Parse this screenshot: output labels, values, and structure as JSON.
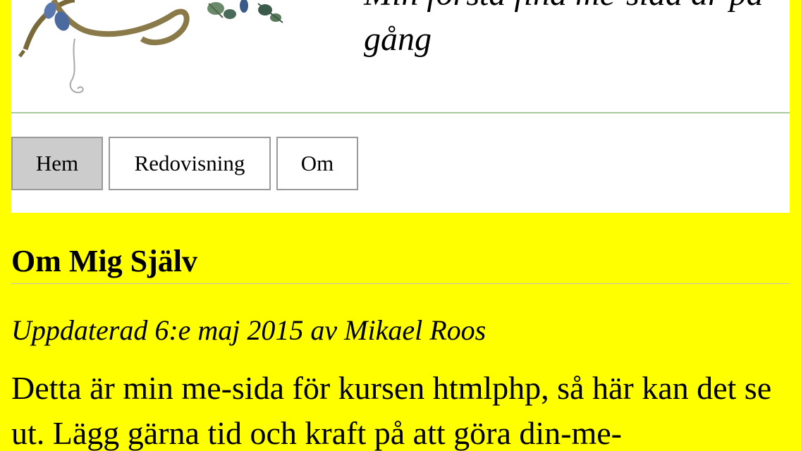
{
  "header": {
    "slogan": "Min första fina me-sida är på gång",
    "logo_icon": "branch-illustration-icon",
    "rule_color": "#a8c8a0"
  },
  "nav": {
    "items": [
      {
        "label": "Hem",
        "selected": true
      },
      {
        "label": "Redovisning",
        "selected": false
      },
      {
        "label": "Om",
        "selected": false
      }
    ]
  },
  "main": {
    "title": "Om Mig Själv",
    "byline": "Uppdaterad 6:e maj 2015 av Mikael Roos",
    "body": "Detta är min me-sida för kursen htmlphp, så här kan det se ut. Lägg gärna tid och kraft på att göra din-me-"
  },
  "colors": {
    "page_background": "#ffff00",
    "panel_background": "#ffffff",
    "nav_selected_background": "#cccccc",
    "nav_border": "#9a9a9a"
  }
}
